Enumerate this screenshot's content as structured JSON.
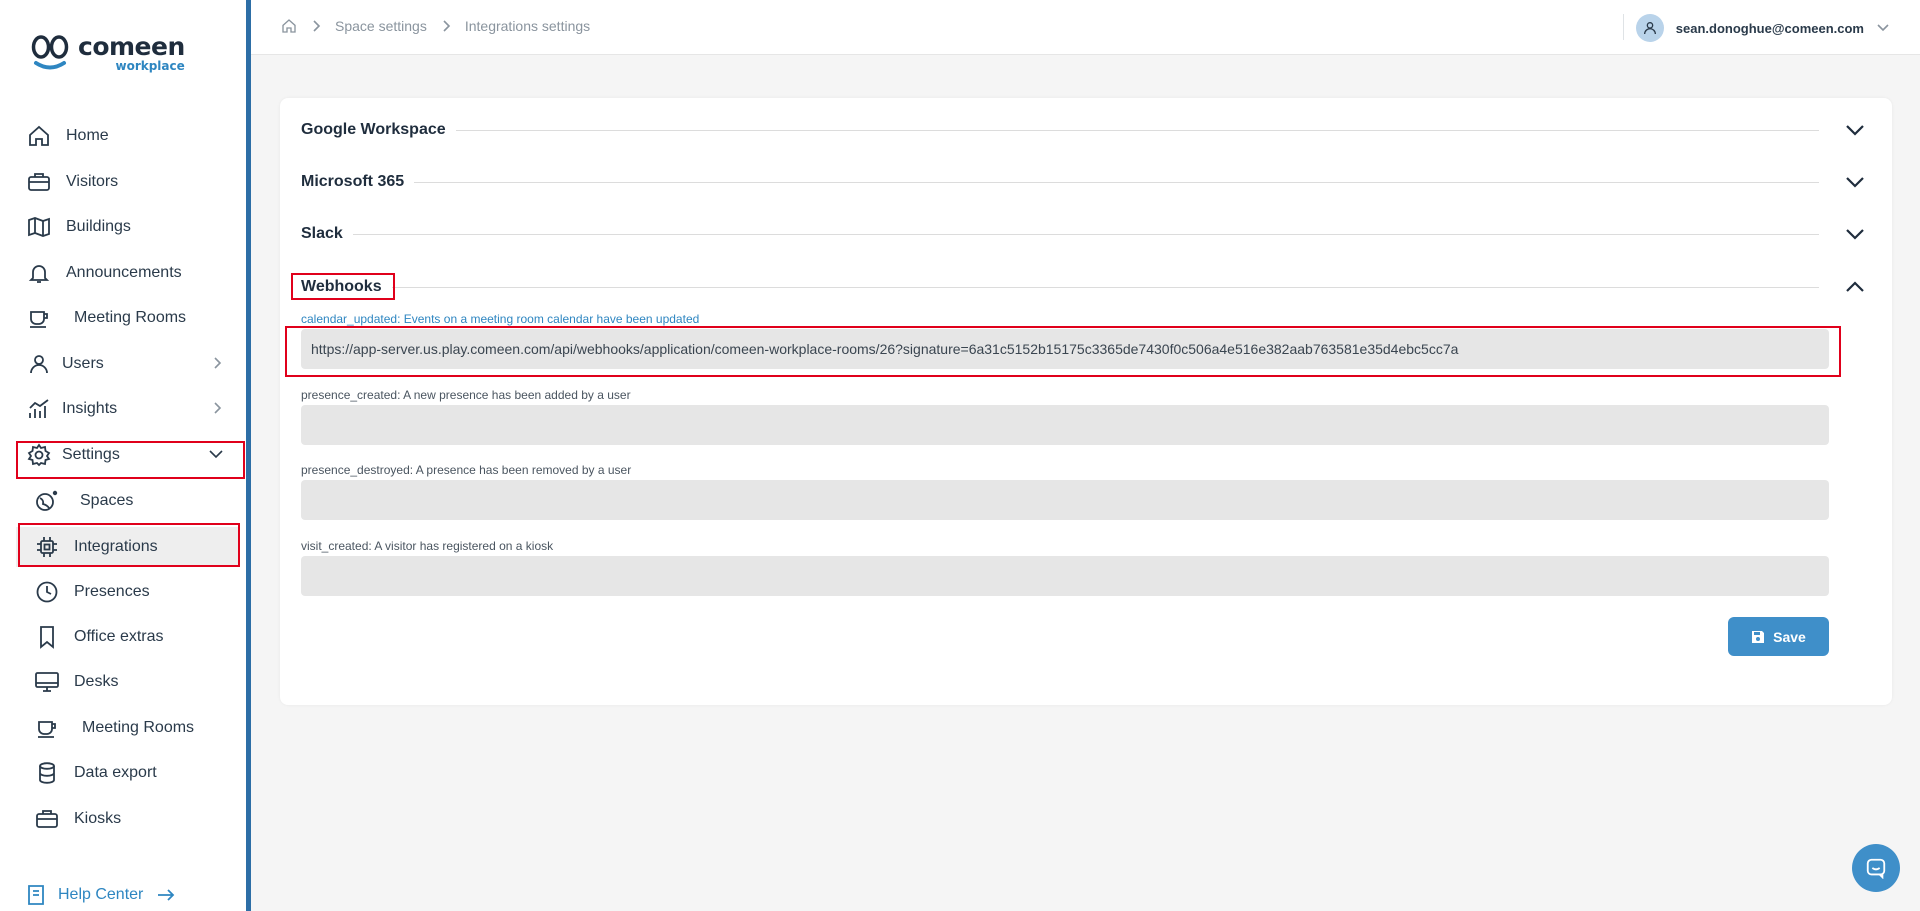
{
  "brand": {
    "name": "comeen",
    "sub": "workplace"
  },
  "sidebar": {
    "items": [
      {
        "label": "Home",
        "icon": "home-icon"
      },
      {
        "label": "Visitors",
        "icon": "briefcase-icon"
      },
      {
        "label": "Buildings",
        "icon": "map-icon"
      },
      {
        "label": "Announcements",
        "icon": "bell-icon"
      },
      {
        "label": "Meeting Rooms",
        "icon": "cup-icon"
      },
      {
        "label": "Users",
        "icon": "user-icon"
      },
      {
        "label": "Insights",
        "icon": "chart-icon"
      },
      {
        "label": "Settings",
        "icon": "gear-icon"
      }
    ],
    "settings_children": [
      {
        "label": "Spaces",
        "icon": "globe-icon"
      },
      {
        "label": "Integrations",
        "icon": "chip-icon"
      },
      {
        "label": "Presences",
        "icon": "clock-icon"
      },
      {
        "label": "Office extras",
        "icon": "bookmark-icon"
      },
      {
        "label": "Desks",
        "icon": "monitor-icon"
      },
      {
        "label": "Meeting Rooms",
        "icon": "cup-icon"
      },
      {
        "label": "Data export",
        "icon": "database-icon"
      },
      {
        "label": "Kiosks",
        "icon": "briefcase-icon"
      }
    ],
    "help": "Help Center"
  },
  "topbar": {
    "breadcrumbs": [
      "Space settings",
      "Integrations settings"
    ],
    "user_email": "sean.donoghue@comeen.com"
  },
  "integrations": {
    "sections": [
      "Google Workspace",
      "Microsoft 365",
      "Slack",
      "Webhooks"
    ],
    "webhooks": [
      {
        "label": "calendar_updated: Events on a meeting room calendar have been updated",
        "value": "https://app-server.us.play.comeen.com/api/webhooks/application/comeen-workplace-rooms/26?signature=6a31c5152b15175c3365de7430f0c506a4e516e382aab763581e35d4ebc5cc7a"
      },
      {
        "label": "presence_created: A new presence has been added by a user",
        "value": ""
      },
      {
        "label": "presence_destroyed: A presence has been removed by a user",
        "value": ""
      },
      {
        "label": "visit_created: A visitor has registered on a kiosk",
        "value": ""
      }
    ],
    "save_label": "Save"
  },
  "colors": {
    "accent": "#2e86c1",
    "highlight": "#e0001b",
    "sidebar_bar": "#2d6ea6"
  }
}
